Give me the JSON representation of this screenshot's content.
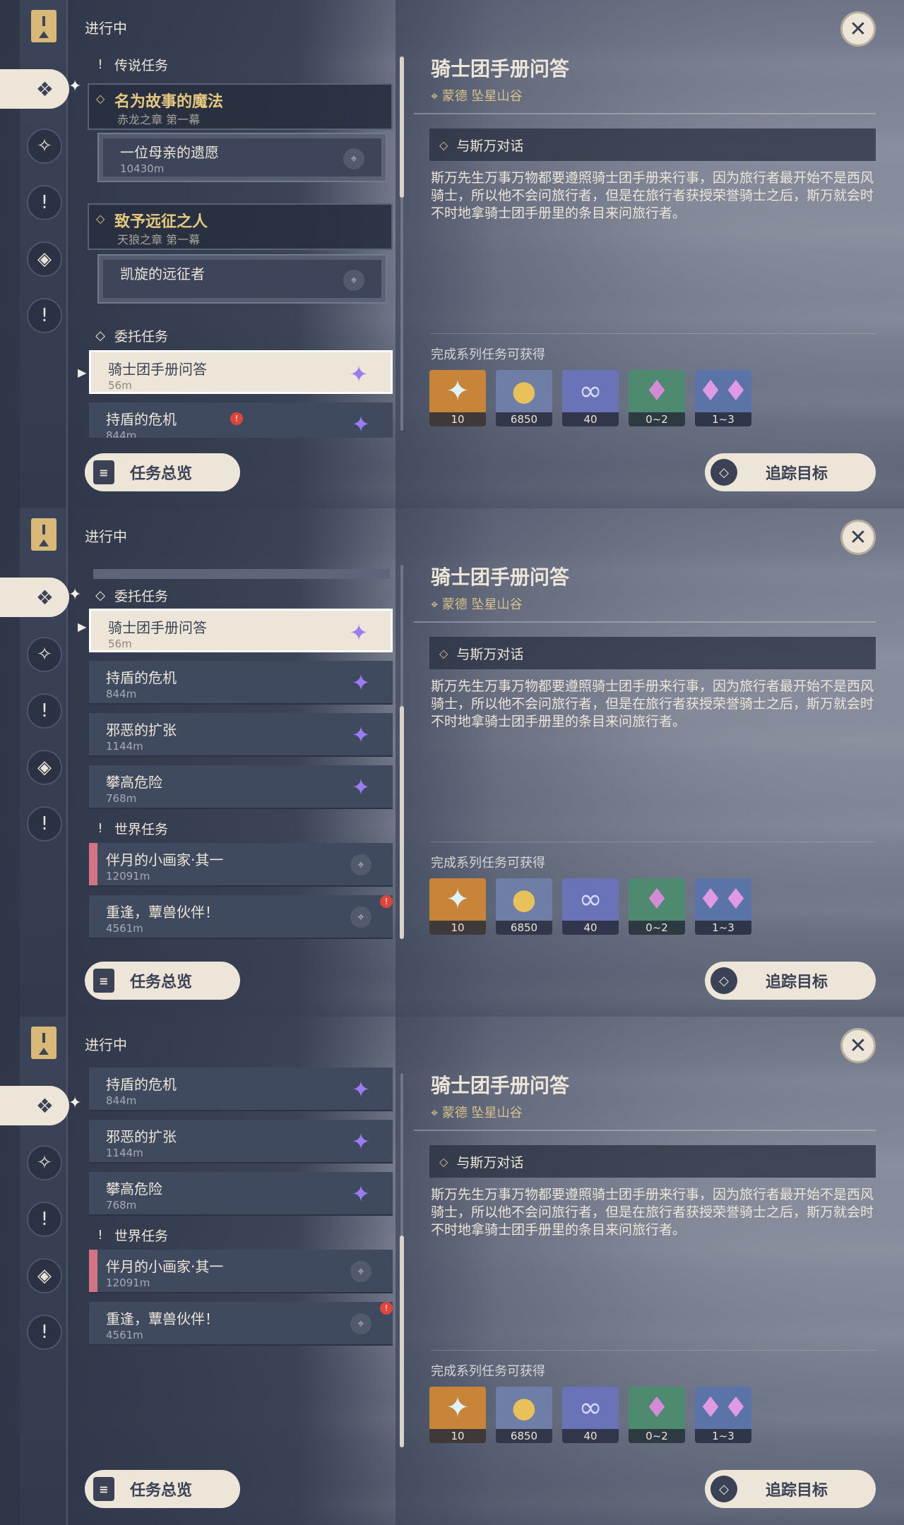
{
  "status": "进行中",
  "sections": {
    "legend": "传说任务",
    "commission": "委托任务",
    "world": "世界任务"
  },
  "legend_quests": [
    {
      "title": "名为故事的魔法",
      "chapter": "赤龙之章 第一幕",
      "sub_title": "一位母亲的遗愿",
      "sub_distance": "10430m"
    },
    {
      "title": "致予远征之人",
      "chapter": "天狼之章 第一幕",
      "sub_title": "凯旋的远征者",
      "sub_distance": ""
    }
  ],
  "commission_quests": [
    {
      "title": "骑士团手册问答",
      "distance": "56m"
    },
    {
      "title": "持盾的危机",
      "distance": "844m"
    },
    {
      "title": "邪恶的扩张",
      "distance": "1144m"
    },
    {
      "title": "攀高危险",
      "distance": "768m"
    }
  ],
  "world_quests": [
    {
      "title": "伴月的小画家·其一",
      "distance": "12091m"
    },
    {
      "title": "重逢，蕈兽伙伴！",
      "distance": "4561m"
    }
  ],
  "detail": {
    "title": "骑士团手册问答",
    "location": "蒙德 坠星山谷",
    "objective": "与斯万对话",
    "description": "斯万先生万事万物都要遵照骑士团手册来行事，因为旅行者最开始不是西风骑士，所以他不会问旅行者，但是在旅行者获授荣誉骑士之后，斯万就会时不时地拿骑士团手册里的条目来问旅行者。",
    "rewards_label": "完成系列任务可获得",
    "rewards": [
      {
        "icon": "primogem-icon",
        "amount": "10",
        "bg": "#c8853a"
      },
      {
        "icon": "mora-icon",
        "amount": "6850",
        "bg": "#6e7ea6"
      },
      {
        "icon": "adventure-exp-icon",
        "amount": "40",
        "bg": "#6a73b8"
      },
      {
        "icon": "crystal-chunk-icon",
        "amount": "0~2",
        "bg": "#4e8a70"
      },
      {
        "icon": "crystal-cluster-icon",
        "amount": "1~3",
        "bg": "#5a74a8"
      }
    ]
  },
  "buttons": {
    "overview": "任务总览",
    "track": "追踪目标"
  },
  "icons": {
    "close": "close-icon",
    "pin": "location-pin-icon",
    "commission": "commission-gem-icon",
    "alert": "alert-icon"
  },
  "colors": {
    "accent": "#ece5d8",
    "gold": "#e6c87e",
    "gem": "#9a7cf0",
    "alert": "#e0453a",
    "world_bar": "#d37485"
  },
  "glyphs": {
    "pin": "⌖",
    "gem": "✦",
    "alert": "!",
    "close": "✕",
    "diamond": "◇",
    "legend_mark": "!",
    "spark": "✦"
  }
}
